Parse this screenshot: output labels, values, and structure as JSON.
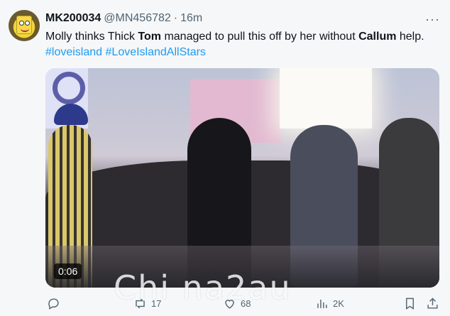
{
  "tweet": {
    "display_name": "MK200034",
    "handle": "@MN456782",
    "separator": "·",
    "time": "16m",
    "more_label": "···",
    "text_before_tom": "Molly thinks Thick ",
    "bold_tom": "Tom",
    "text_middle": " managed to pull this off by her without ",
    "bold_callum": "Callum",
    "text_after": " help.",
    "hashtags": [
      "#loveisland",
      "#LoveIslandAllStars"
    ]
  },
  "media": {
    "duration": "0:06",
    "watermark": "Chi na2au"
  },
  "actions": {
    "reply_count": "",
    "retweet_count": "17",
    "like_count": "68",
    "views_count": "2K"
  },
  "colors": {
    "link": "#1d9bf0",
    "secondary_text": "#536471",
    "primary_text": "#0f1419",
    "background": "#f5f7f9"
  },
  "icons": [
    "reply-icon",
    "retweet-icon",
    "like-icon",
    "views-icon",
    "bookmark-icon",
    "share-icon",
    "more-icon"
  ]
}
